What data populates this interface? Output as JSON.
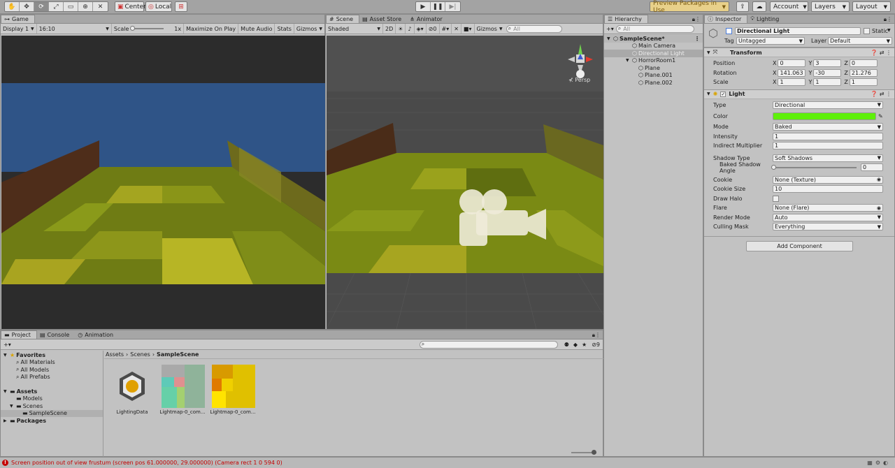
{
  "toolbar": {
    "tools": [
      "hand-tool-icon",
      "move-tool-icon",
      "rotate-tool-icon",
      "scale-tool-icon",
      "rect-tool-icon",
      "transform-tool-icon",
      "custom-tool-icon"
    ],
    "pivot_label": "Center",
    "space_label": "Local",
    "preview_packages": "Preview Packages in Use",
    "account": "Account",
    "layers": "Layers",
    "layout": "Layout"
  },
  "game": {
    "tab": "Game",
    "display": "Display 1",
    "aspect": "16:10",
    "scale_label": "Scale",
    "scale_value": "1x",
    "maximize": "Maximize On Play",
    "mute": "Mute Audio",
    "stats": "Stats",
    "gizmos": "Gizmos"
  },
  "scene": {
    "tabs": [
      "Scene",
      "Asset Store",
      "Animator"
    ],
    "shading": "Shaded",
    "mode2d": "2D",
    "hidden_count": "0",
    "gizmos": "Gizmos",
    "search_placeholder": "All",
    "persp": "Persp"
  },
  "hierarchy": {
    "tab": "Hierarchy",
    "search_placeholder": "All",
    "items": [
      {
        "label": "SampleScene*",
        "depth": 0,
        "bold": true
      },
      {
        "label": "Main Camera",
        "depth": 1
      },
      {
        "label": "Directional Light",
        "depth": 1,
        "selected": true
      },
      {
        "label": "HorrorRoom1",
        "depth": 1
      },
      {
        "label": "Plane",
        "depth": 2
      },
      {
        "label": "Plane.001",
        "depth": 2
      },
      {
        "label": "Plane.002",
        "depth": 2
      }
    ]
  },
  "inspector": {
    "tabs": [
      "Inspector",
      "Lighting"
    ],
    "object_name": "Directional Light",
    "static_label": "Static",
    "tag_label": "Tag",
    "tag_value": "Untagged",
    "layer_label": "Layer",
    "layer_value": "Default",
    "transform": {
      "title": "Transform",
      "position_label": "Position",
      "position": {
        "x": "0",
        "y": "3",
        "z": "0"
      },
      "rotation_label": "Rotation",
      "rotation": {
        "x": "141.063",
        "y": "-30",
        "z": "21.276"
      },
      "scale_label": "Scale",
      "scale": {
        "x": "1",
        "y": "1",
        "z": "1"
      }
    },
    "light": {
      "title": "Light",
      "type_label": "Type",
      "type_value": "Directional",
      "color_label": "Color",
      "color_value": "#5ef00a",
      "mode_label": "Mode",
      "mode_value": "Baked",
      "intensity_label": "Intensity",
      "intensity_value": "1",
      "indirect_label": "Indirect Multiplier",
      "indirect_value": "1",
      "shadow_type_label": "Shadow Type",
      "shadow_type_value": "Soft Shadows",
      "baked_angle_label": "Baked Shadow Angle",
      "baked_angle_value": "0",
      "cookie_label": "Cookie",
      "cookie_value": "None (Texture)",
      "cookie_size_label": "Cookie Size",
      "cookie_size_value": "10",
      "draw_halo_label": "Draw Halo",
      "flare_label": "Flare",
      "flare_value": "None (Flare)",
      "render_mode_label": "Render Mode",
      "render_mode_value": "Auto",
      "culling_label": "Culling Mask",
      "culling_value": "Everything"
    },
    "add_component": "Add Component"
  },
  "project": {
    "tabs": [
      "Project",
      "Console",
      "Animation"
    ],
    "search_placeholder": "",
    "hidden_count": "9",
    "favorites_label": "Favorites",
    "favorites": [
      "All Materials",
      "All Models",
      "All Prefabs"
    ],
    "assets_label": "Assets",
    "asset_folders": [
      "Models",
      "Scenes",
      "SampleScene"
    ],
    "packages_label": "Packages",
    "breadcrumb": [
      "Assets",
      "Scenes",
      "SampleScene"
    ],
    "assets": [
      "LightingData",
      "Lightmap-0_com...",
      "Lightmap-0_com..."
    ]
  },
  "status": {
    "message": "Screen position out of view frustum (screen pos 61.000000, 29.000000) (Camera rect 1 0 594 0)"
  }
}
